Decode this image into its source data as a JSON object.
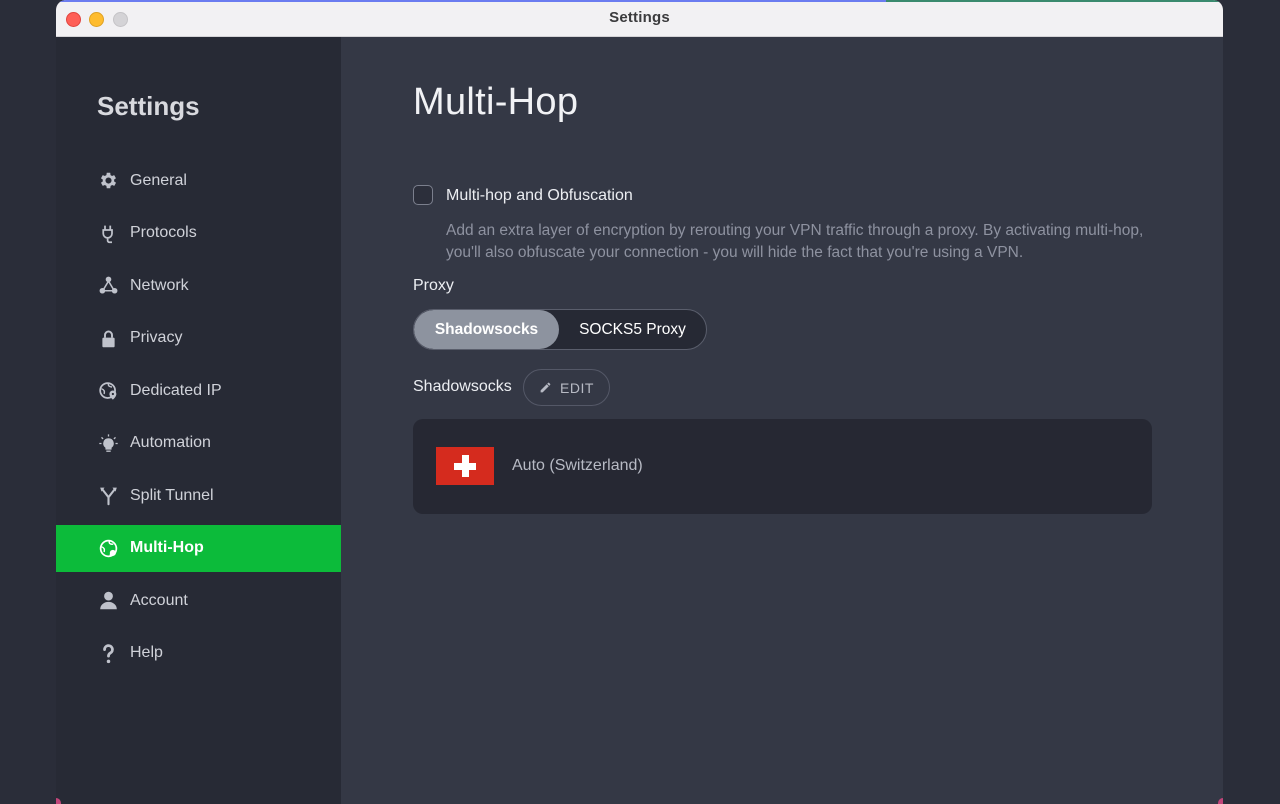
{
  "window": {
    "title": "Settings"
  },
  "sidebar": {
    "title": "Settings",
    "items": [
      {
        "label": "General",
        "icon": "gear-icon",
        "active": false
      },
      {
        "label": "Protocols",
        "icon": "plug-icon",
        "active": false
      },
      {
        "label": "Network",
        "icon": "network-icon",
        "active": false
      },
      {
        "label": "Privacy",
        "icon": "lock-icon",
        "active": false
      },
      {
        "label": "Dedicated IP",
        "icon": "globe-pin-icon",
        "active": false
      },
      {
        "label": "Automation",
        "icon": "lightbulb-icon",
        "active": false
      },
      {
        "label": "Split Tunnel",
        "icon": "split-icon",
        "active": false
      },
      {
        "label": "Multi-Hop",
        "icon": "multihop-globe-icon",
        "active": true
      },
      {
        "label": "Account",
        "icon": "user-icon",
        "active": false
      },
      {
        "label": "Help",
        "icon": "question-icon",
        "active": false
      }
    ]
  },
  "main": {
    "title": "Multi-Hop",
    "multihop": {
      "checked": false,
      "label": "Multi-hop and Obfuscation",
      "description": "Add an extra layer of encryption by rerouting your VPN traffic through a proxy. By activating multi-hop, you'll also obfuscate your connection - you will hide the fact that you're using a VPN."
    },
    "proxy": {
      "label": "Proxy",
      "options": [
        "Shadowsocks",
        "SOCKS5 Proxy"
      ],
      "selected": "Shadowsocks"
    },
    "shadowsocks": {
      "label": "Shadowsocks",
      "edit_label": "EDIT",
      "location": "Auto (Switzerland)",
      "flag": "switzerland-flag-icon"
    }
  },
  "colors": {
    "active_green": "#0cbb3a",
    "sidebar_bg": "#272a35",
    "main_bg": "#343845"
  }
}
